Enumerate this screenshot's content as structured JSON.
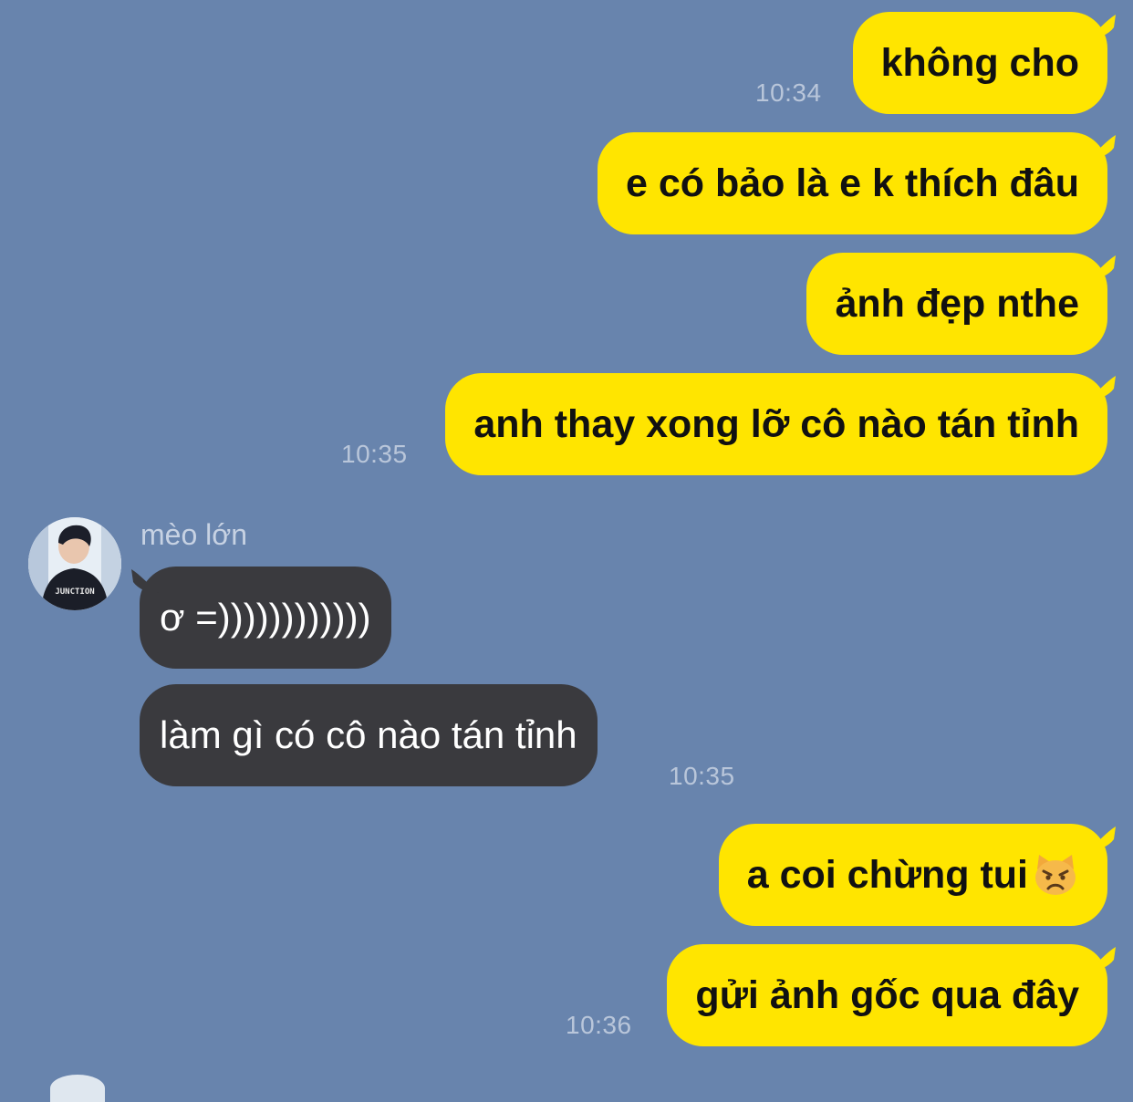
{
  "chat": {
    "outgoing_1": {
      "messages": [
        "không cho",
        "e có bảo là e k thích đâu",
        "ảnh đẹp nthe",
        "anh thay xong lỡ cô nào tán tỉnh"
      ],
      "time_first": "10:34",
      "time_last": "10:35"
    },
    "incoming": {
      "sender": "mèo lớn",
      "messages": [
        "ơ =))))))))))))",
        "làm gì có cô nào tán tỉnh"
      ],
      "time": "10:35",
      "avatar_icon": "avatar-photo"
    },
    "outgoing_2": {
      "messages": [
        "a coi chừng tui",
        "gửi ảnh gốc qua đây"
      ],
      "emoji": "pouting-cat-emoji",
      "time": "10:36"
    }
  },
  "colors": {
    "background": "#6884ad",
    "outgoing_bubble": "#ffe500",
    "incoming_bubble": "#3a3a3e",
    "timestamp": "#b9c6da"
  }
}
